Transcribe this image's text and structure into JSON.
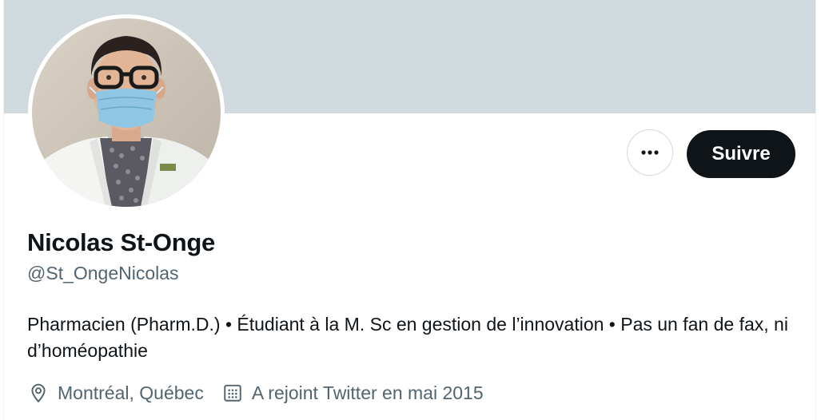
{
  "profile": {
    "display_name": "Nicolas St-Onge",
    "handle": "@St_OngeNicolas",
    "bio": "Pharmacien (Pharm.D.) • Étudiant à la M. Sc en gestion de l’innovation • Pas un fan de fax, ni d’homéopathie",
    "location": "Montréal, Québec",
    "joined": "A rejoint Twitter en mai 2015",
    "location_icon": "location-pin-icon",
    "joined_icon": "calendar-icon",
    "avatar_icon": "profile-photo"
  },
  "actions": {
    "more_icon": "more-dots-icon",
    "follow_label": "Suivre"
  },
  "colors": {
    "banner": "#cfd9de",
    "primary_text": "#0f1419",
    "secondary_text": "#536471",
    "follow_bg": "#0f1419",
    "follow_text": "#ffffff"
  }
}
